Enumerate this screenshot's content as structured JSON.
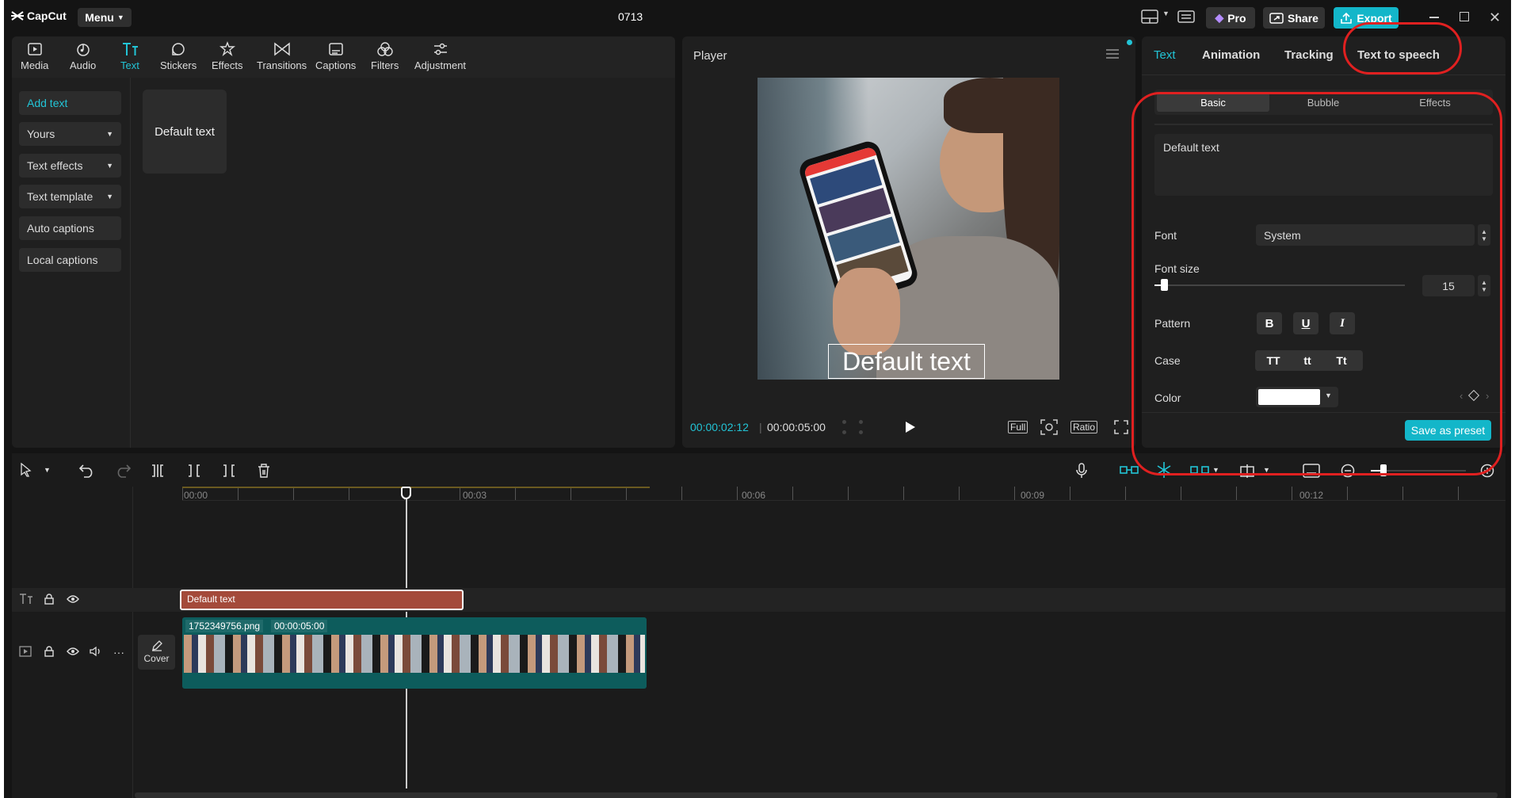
{
  "app": {
    "logo": "CapCut",
    "menu_label": "Menu",
    "project_title": "0713"
  },
  "header": {
    "pro_label": "Pro",
    "share_label": "Share",
    "export_label": "Export"
  },
  "toolbar": [
    {
      "label": "Media",
      "icon": "media-icon"
    },
    {
      "label": "Audio",
      "icon": "audio-icon"
    },
    {
      "label": "Text",
      "icon": "text-icon"
    },
    {
      "label": "Stickers",
      "icon": "stickers-icon"
    },
    {
      "label": "Effects",
      "icon": "effects-icon"
    },
    {
      "label": "Transitions",
      "icon": "transitions-icon"
    },
    {
      "label": "Captions",
      "icon": "captions-icon"
    },
    {
      "label": "Filters",
      "icon": "filters-icon"
    },
    {
      "label": "Adjustment",
      "icon": "adjustment-icon"
    }
  ],
  "sidebar": {
    "items": [
      "Add text",
      "Yours",
      "Text effects",
      "Text template",
      "Auto captions",
      "Local captions"
    ]
  },
  "library": {
    "card_label": "Default text"
  },
  "player": {
    "title": "Player",
    "overlay_text": "Default text",
    "current_time": "00:00:02:12",
    "total_time": "00:00:05:00",
    "full_label": "Full",
    "ratio_label": "Ratio"
  },
  "inspector": {
    "tabs": [
      "Text",
      "Animation",
      "Tracking",
      "Text to speech"
    ],
    "subtabs": [
      "Basic",
      "Bubble",
      "Effects"
    ],
    "text_value": "Default text",
    "font_label": "Font",
    "font_value": "System",
    "font_size_label": "Font size",
    "font_size_value": "15",
    "pattern_label": "Pattern",
    "pattern_buttons": [
      "B",
      "U",
      "I"
    ],
    "case_label": "Case",
    "case_buttons": [
      "TT",
      "tt",
      "Tt"
    ],
    "color_label": "Color",
    "color_value": "#ffffff",
    "save_preset_label": "Save as preset"
  },
  "timeline": {
    "ruler": [
      "00:00",
      "00:03",
      "00:06",
      "00:09",
      "00:12"
    ],
    "text_clip": "Default text",
    "video_clip_name": "1752349756.png",
    "video_clip_duration": "00:00:05:00",
    "cover_label": "Cover"
  },
  "colors": {
    "accent": "#22c4d6",
    "panel": "#1f1f1f",
    "text_clip": "#a44a3a",
    "video_clip": "#0d5c5c",
    "annotation": "#e02020"
  }
}
